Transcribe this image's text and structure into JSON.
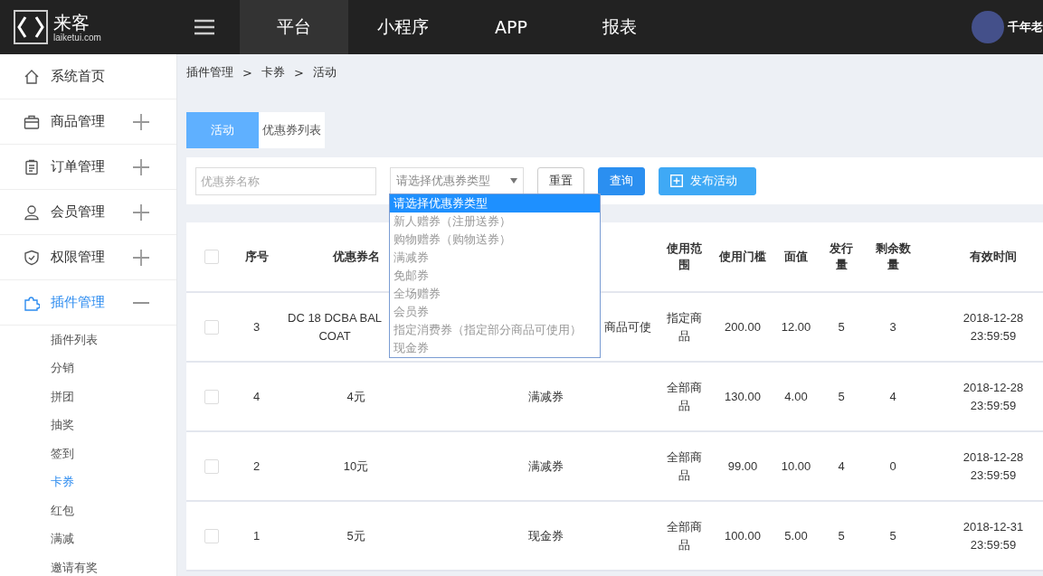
{
  "logo": {
    "name": "来客",
    "domain": "laiketui.com"
  },
  "nav": [
    {
      "label": "平台",
      "selected": true
    },
    {
      "label": "小程序",
      "selected": false
    },
    {
      "label": "APP",
      "selected": false
    },
    {
      "label": "报表",
      "selected": false
    }
  ],
  "user": {
    "name": "千年老"
  },
  "sidebar": {
    "items": [
      {
        "label": "系统首页",
        "kind": "home",
        "expandable": false,
        "expanded": false
      },
      {
        "label": "商品管理",
        "kind": "bag",
        "expandable": true,
        "expanded": false
      },
      {
        "label": "订单管理",
        "kind": "list",
        "expandable": true,
        "expanded": false
      },
      {
        "label": "会员管理",
        "kind": "user",
        "expandable": true,
        "expanded": false
      },
      {
        "label": "权限管理",
        "kind": "shield",
        "expandable": true,
        "expanded": false
      },
      {
        "label": "插件管理",
        "kind": "puzzle",
        "expandable": true,
        "expanded": true,
        "children": [
          {
            "label": "插件列表",
            "selected": false
          },
          {
            "label": "分销",
            "selected": false
          },
          {
            "label": "拼团",
            "selected": false
          },
          {
            "label": "抽奖",
            "selected": false
          },
          {
            "label": "签到",
            "selected": false
          },
          {
            "label": "卡券",
            "selected": true
          },
          {
            "label": "红包",
            "selected": false
          },
          {
            "label": "满减",
            "selected": false
          },
          {
            "label": "邀请有奖",
            "selected": false
          }
        ]
      }
    ]
  },
  "breadcrumb": {
    "items": [
      "插件管理",
      "卡券",
      "活动"
    ],
    "separators": [
      ">",
      ">"
    ]
  },
  "tabs": [
    {
      "label": "活动",
      "selected": true
    },
    {
      "label": "优惠券列表",
      "selected": false
    }
  ],
  "filters": {
    "name_placeholder": "优惠券名称",
    "type_select": "请选择优惠券类型",
    "reset": "重置",
    "search": "查询",
    "publish": "发布活动"
  },
  "dropdown": {
    "options": [
      {
        "label": "请选择优惠券类型",
        "selected": true
      },
      {
        "label": "新人赠券（注册送券）",
        "selected": false
      },
      {
        "label": "购物赠券（购物送券）",
        "selected": false
      },
      {
        "label": "满减券",
        "selected": false
      },
      {
        "label": "免邮券",
        "selected": false
      },
      {
        "label": "全场赠券",
        "selected": false
      },
      {
        "label": "会员券",
        "selected": false
      },
      {
        "label": "指定消费券（指定部分商品可使用）",
        "selected": false
      },
      {
        "label": "现金券",
        "selected": false
      }
    ]
  },
  "table": {
    "all_checked": false,
    "columns": [
      {
        "label": "序号"
      },
      {
        "label": "优惠券名"
      },
      {},
      {
        "label": "使用范围"
      },
      {
        "label": "使用门槛"
      },
      {
        "label": "面值"
      },
      {
        "label": "发行量"
      },
      {
        "label": "剩余数量"
      },
      {
        "label": "有效时间"
      }
    ],
    "rows": [
      {
        "checked": false,
        "cells": [
          "3",
          "DC 18 DCBA BAL\nCOAT",
          "商品可使",
          "指定商品",
          "200.00",
          "12.00",
          "5",
          "3",
          "2018-12-28 23:59:59"
        ],
        "cut": true
      },
      {
        "checked": false,
        "cells": [
          "4",
          "4元",
          "满减券",
          "全部商品",
          "130.00",
          "4.00",
          "5",
          "4",
          "2018-12-28 23:59:59"
        ],
        "cut": false
      },
      {
        "checked": false,
        "cells": [
          "2",
          "10元",
          "满减券",
          "全部商品",
          "99.00",
          "10.00",
          "4",
          "0",
          "2018-12-28 23:59:59"
        ],
        "cut": false
      },
      {
        "checked": false,
        "cells": [
          "1",
          "5元",
          "现金券",
          "全部商品",
          "100.00",
          "5.00",
          "5",
          "5",
          "2018-12-31 23:59:59"
        ],
        "cut": false
      }
    ]
  }
}
